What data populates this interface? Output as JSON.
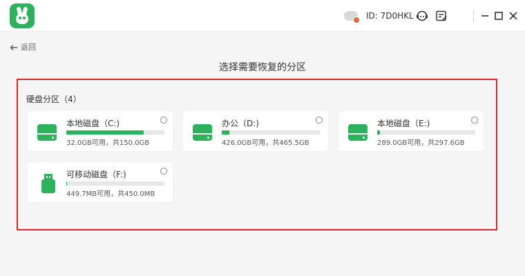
{
  "header": {
    "user_id": "ID: 7D0HKL",
    "icons": [
      "app-logo-icon",
      "cloud-avatar-icon",
      "support-icon",
      "feedback-icon",
      "minimize-icon",
      "maximize-icon",
      "close-icon"
    ]
  },
  "nav": {
    "back_label": "返回"
  },
  "page": {
    "title": "选择需要恢复的分区"
  },
  "section": {
    "title": "硬盘分区（4）"
  },
  "partitions": [
    {
      "name": "本地磁盘（C:)",
      "usage": "32.0GB可用，共150.0GB",
      "used_fraction": 0.79,
      "type": "hdd"
    },
    {
      "name": "办公（D:)",
      "usage": "426.0GB可用，共465.5GB",
      "used_fraction": 0.08,
      "type": "hdd"
    },
    {
      "name": "本地磁盘（E:)",
      "usage": "289.0GB可用，共297.6GB",
      "used_fraction": 0.03,
      "type": "hdd"
    },
    {
      "name": "可移动磁盘（F:)",
      "usage": "449.7MB可用，共450.0MB",
      "used_fraction": 0.01,
      "type": "usb"
    }
  ],
  "colors": {
    "accent": "#2db15c",
    "highlight": "#d9262c",
    "background": "#f5f5f5"
  }
}
